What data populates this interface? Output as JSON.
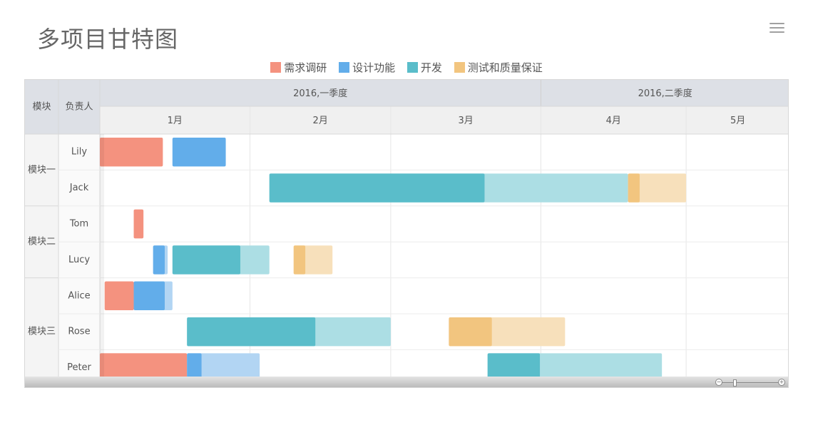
{
  "title": "多项目甘特图",
  "menu_icon": "hamburger-menu-icon",
  "colors": {
    "需求调研": "#f4927f",
    "设计功能": "#62adea",
    "开发": "#5abdca",
    "测试和质量保证": "#f2c57f",
    "header_bg": "#dde0e6",
    "month_bg": "#f0f0f0",
    "col_bg": "#f4f4f4"
  },
  "header": {
    "col_module": "模块",
    "col_owner": "负责人",
    "quarters": [
      "2016,一季度",
      "2016,二季度"
    ],
    "months": [
      "1月",
      "2月",
      "3月",
      "4月",
      "5月"
    ]
  },
  "chart_data": {
    "type": "gantt",
    "title": "多项目甘特图",
    "legend": [
      "需求调研",
      "设计功能",
      "开发",
      "测试和质量保证"
    ],
    "legend_position": "top-center",
    "x_axis": {
      "type": "date",
      "min": "2016-01-01",
      "max": "2016-05-31"
    },
    "modules": [
      {
        "name": "模块一",
        "owners": [
          "Lily",
          "Jack"
        ]
      },
      {
        "name": "模块二",
        "owners": [
          "Tom",
          "Lucy"
        ]
      },
      {
        "name": "模块三",
        "owners": [
          "Alice",
          "Rose",
          "Peter"
        ]
      }
    ],
    "tasks": [
      {
        "owner": "Lily",
        "phase": "需求调研",
        "start": "2016-01-01",
        "end": "2016-01-14",
        "progress": 1
      },
      {
        "owner": "Lily",
        "phase": "设计功能",
        "start": "2016-01-16",
        "end": "2016-01-27",
        "progress": 1
      },
      {
        "owner": "Jack",
        "phase": "开发",
        "start": "2016-02-05",
        "end": "2016-04-19",
        "progress": 0.6
      },
      {
        "owner": "Jack",
        "phase": "测试和质量保证",
        "start": "2016-04-19",
        "end": "2016-05-01",
        "progress": 0.2
      },
      {
        "owner": "Tom",
        "phase": "需求调研",
        "start": "2016-01-08",
        "end": "2016-01-10",
        "progress": 1
      },
      {
        "owner": "Lucy",
        "phase": "设计功能",
        "start": "2016-01-12",
        "end": "2016-01-15",
        "progress": 0.8
      },
      {
        "owner": "Lucy",
        "phase": "开发",
        "start": "2016-01-16",
        "end": "2016-02-05",
        "progress": 0.7
      },
      {
        "owner": "Lucy",
        "phase": "测试和质量保证",
        "start": "2016-02-10",
        "end": "2016-02-18",
        "progress": 0.3
      },
      {
        "owner": "Alice",
        "phase": "需求调研",
        "start": "2016-01-02",
        "end": "2016-01-08",
        "progress": 1
      },
      {
        "owner": "Alice",
        "phase": "设计功能",
        "start": "2016-01-08",
        "end": "2016-01-16",
        "progress": 0.8
      },
      {
        "owner": "Rose",
        "phase": "开发",
        "start": "2016-01-19",
        "end": "2016-03-01",
        "progress": 0.63
      },
      {
        "owner": "Rose",
        "phase": "测试和质量保证",
        "start": "2016-03-13",
        "end": "2016-04-06",
        "progress": 0.37
      },
      {
        "owner": "Peter",
        "phase": "需求调研",
        "start": "2016-01-01",
        "end": "2016-01-19",
        "progress": 1
      },
      {
        "owner": "Peter",
        "phase": "设计功能",
        "start": "2016-01-19",
        "end": "2016-02-03",
        "progress": 0.2
      },
      {
        "owner": "Peter",
        "phase": "开发",
        "start": "2016-03-21",
        "end": "2016-04-26",
        "progress": 0.3
      }
    ]
  }
}
